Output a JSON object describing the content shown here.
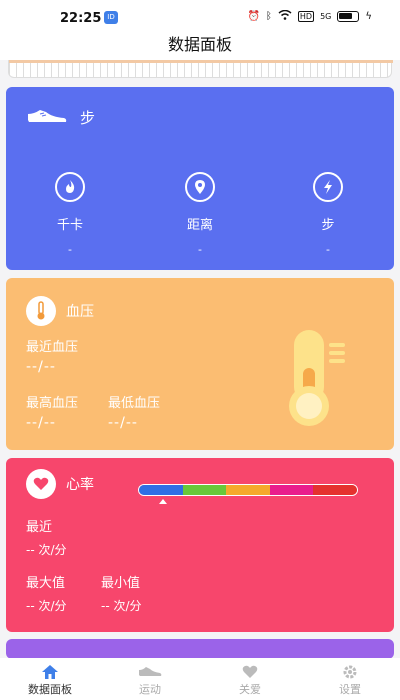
{
  "status_bar": {
    "time": "22:25",
    "app_badge": "ID",
    "hd_label": "HD",
    "signal_label": "5G"
  },
  "header": {
    "title": "数据面板"
  },
  "steps_card": {
    "title": "步",
    "stats": [
      {
        "icon": "flame-icon",
        "label": "千卡",
        "value": "-"
      },
      {
        "icon": "location-icon",
        "label": "距离",
        "value": "-"
      },
      {
        "icon": "lightning-icon",
        "label": "步",
        "value": "-"
      }
    ]
  },
  "blood_pressure_card": {
    "title": "血压",
    "recent_label": "最近血压",
    "recent_value": "--/--",
    "max_label": "最高血压",
    "max_value": "--/--",
    "min_label": "最低血压",
    "min_value": "--/--"
  },
  "heart_rate_card": {
    "title": "心率",
    "scale_colors": [
      "#2f6fe4",
      "#67c83a",
      "#f5a92b",
      "#e91e8c",
      "#e5322f"
    ],
    "recent_label": "最近",
    "recent_value": "-- 次/分",
    "max_label": "最大值",
    "max_value": "-- 次/分",
    "min_label": "最小值",
    "min_value": "-- 次/分"
  },
  "colors": {
    "accent": "#5a6ff0",
    "blood_pressure": "#fbbd72",
    "heart_rate": "#f7466c"
  },
  "tabs": [
    {
      "label": "数据面板",
      "icon": "home-icon",
      "active": true
    },
    {
      "label": "运动",
      "icon": "shoe-icon",
      "active": false
    },
    {
      "label": "关爱",
      "icon": "heart-icon",
      "active": false
    },
    {
      "label": "设置",
      "icon": "gear-icon",
      "active": false
    }
  ]
}
